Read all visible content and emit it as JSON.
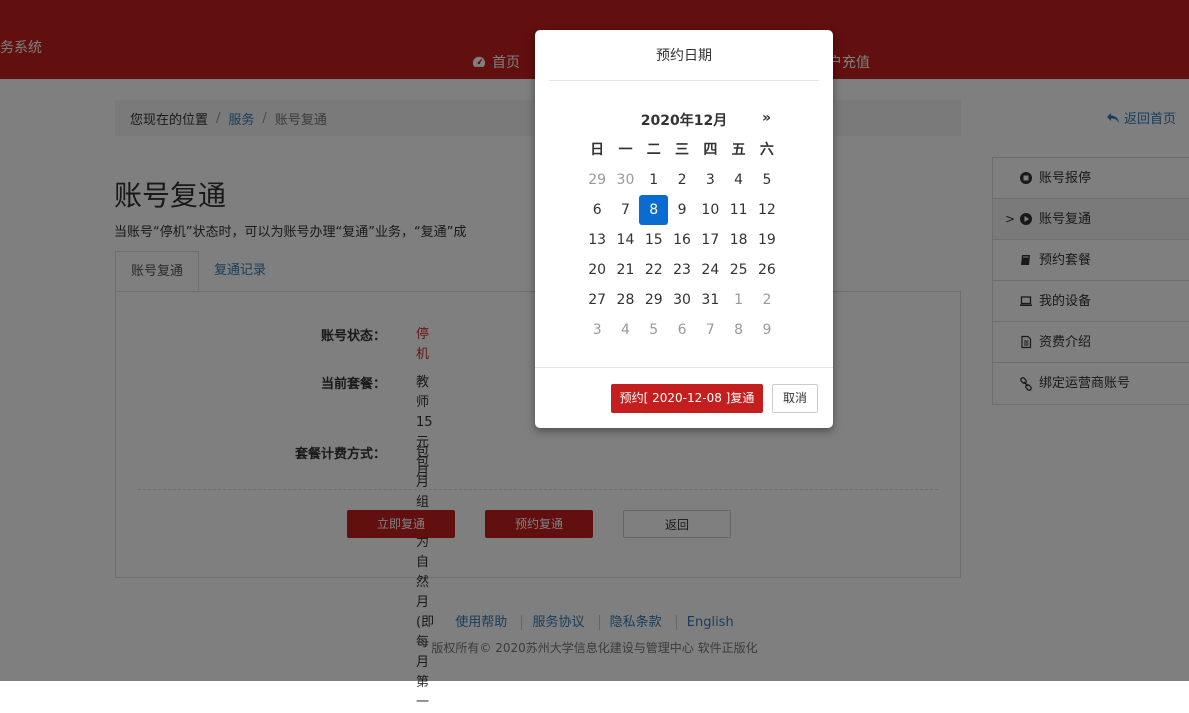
{
  "header": {
    "logo_text": "务系统",
    "nav_home": "首页",
    "nav_recharge": "户充值"
  },
  "breadcrumb": {
    "prefix": "您现在的位置",
    "sep": "/",
    "services": "服务",
    "current": "账号复通"
  },
  "back_home": "返回首页",
  "page": {
    "title": "账号复通",
    "description": "当账号“停机”状态时，可以为账号办理“复通”业务，“复通”成"
  },
  "tabs": {
    "active": "账号复通",
    "records": "复通记录"
  },
  "form": {
    "status_label": "账号状态：",
    "status_value": "停机",
    "package_label": "当前套餐：",
    "package_line1": "教师15元包月组（",
    "package_line2": "为自然月(即每月第一",
    "billing_label": "套餐计费方式：",
    "billing_value": "包月"
  },
  "buttons": {
    "immediate": "立即复通",
    "reserve": "预约复通",
    "back": "返回"
  },
  "sidebar": {
    "items": [
      {
        "label": "账号报停",
        "icon": "stop-circle-icon"
      },
      {
        "label": "账号复通",
        "icon": "play-circle-icon"
      },
      {
        "label": "预约套餐",
        "icon": "book-icon"
      },
      {
        "label": "我的设备",
        "icon": "laptop-icon"
      },
      {
        "label": "资费介绍",
        "icon": "document-icon"
      },
      {
        "label": "绑定运营商账号",
        "icon": "link-icon"
      }
    ],
    "active_marker": ">"
  },
  "footer": {
    "links": [
      "使用帮助",
      "服务协议",
      "隐私条款",
      "English"
    ],
    "copyright": "版权所有© 2020苏州大学信息化建设与管理中心 软件正版化"
  },
  "modal": {
    "title": "预约日期",
    "calendar": {
      "month_title": "2020年12月",
      "next": "»",
      "weekdays": [
        "日",
        "一",
        "二",
        "三",
        "四",
        "五",
        "六"
      ],
      "weeks": [
        [
          "29",
          "30",
          "1",
          "2",
          "3",
          "4",
          "5"
        ],
        [
          "6",
          "7",
          "8",
          "9",
          "10",
          "11",
          "12"
        ],
        [
          "13",
          "14",
          "15",
          "16",
          "17",
          "18",
          "19"
        ],
        [
          "20",
          "21",
          "22",
          "23",
          "24",
          "25",
          "26"
        ],
        [
          "27",
          "28",
          "29",
          "30",
          "31",
          "1",
          "2"
        ],
        [
          "3",
          "4",
          "5",
          "6",
          "7",
          "8",
          "9"
        ]
      ],
      "selected": "8"
    },
    "confirm": "预约[ 2020-12-08 ]复通",
    "cancel": "取消"
  },
  "colors": {
    "brand_red": "#c41e1e",
    "link_blue": "#337ab7",
    "selected_blue": "#0a6cd0"
  }
}
